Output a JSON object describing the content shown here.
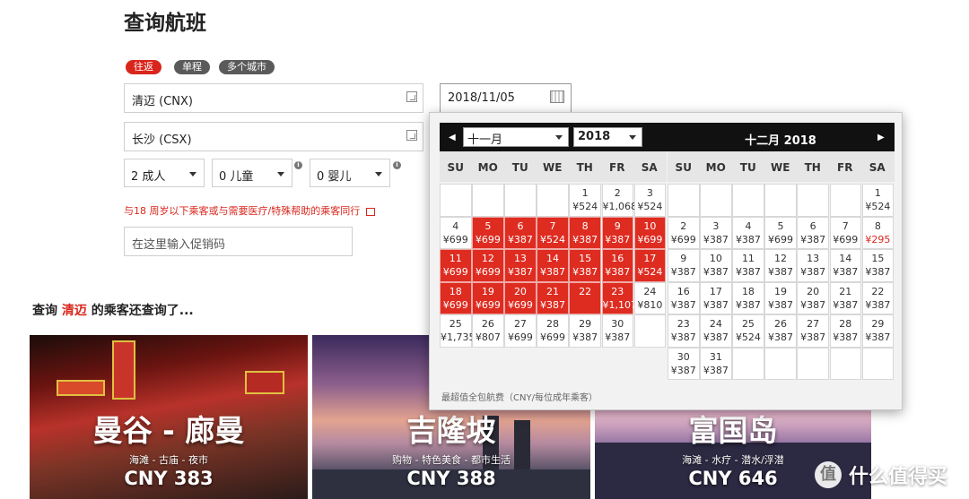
{
  "page_title": "查询航班",
  "trip_types": [
    "往返",
    "单程",
    "多个城市"
  ],
  "origin": "清迈 (CNX)",
  "destination": "长沙 (CSX)",
  "departure_date": "2018/11/05",
  "passengers": {
    "adults": "2 成人",
    "children": "0 儿童",
    "infants": "0 婴儿"
  },
  "assist_note": "与18 周岁以下乘客或与需要医疗/特殊帮助的乘客同行",
  "promo_placeholder": "在这里输入促销码",
  "also_searched": {
    "prefix": "查询 ",
    "city": "清迈",
    "suffix": " 的乘客还查询了..."
  },
  "destinations": [
    {
      "name": "曼谷 - 廊曼",
      "tags": "海滩 - 古庙 - 夜市",
      "price": "CNY 383"
    },
    {
      "name": "吉隆坡",
      "tags": "购物 - 特色美食 - 都市生活",
      "price": "CNY 388"
    },
    {
      "name": "富国岛",
      "tags": "海滩 - 水疗 - 潜水/浮潜",
      "price": "CNY 646"
    }
  ],
  "watermark": "什么值得买",
  "calendar": {
    "left_month_select": "十一月",
    "left_year_select": "2018",
    "right_month_title": "十二月  2018",
    "weekdays": [
      "SU",
      "MO",
      "TU",
      "WE",
      "TH",
      "FR",
      "SA"
    ],
    "footnote": "最超值全包航费（CNY/每位成年乘客）",
    "colors": {
      "selected_range": "#de2c21",
      "highlight_price": "#d9261c"
    },
    "november": [
      {
        "day": "1",
        "price": "¥524"
      },
      {
        "day": "2",
        "price": "¥1,068"
      },
      {
        "day": "3",
        "price": "¥524"
      },
      {
        "day": "4",
        "price": "¥699"
      },
      {
        "day": "5",
        "price": "¥699",
        "red": true
      },
      {
        "day": "6",
        "price": "¥387",
        "red": true
      },
      {
        "day": "7",
        "price": "¥524",
        "red": true
      },
      {
        "day": "8",
        "price": "¥387",
        "red": true
      },
      {
        "day": "9",
        "price": "¥387",
        "red": true
      },
      {
        "day": "10",
        "price": "¥699",
        "red": true
      },
      {
        "day": "11",
        "price": "¥699",
        "red": true
      },
      {
        "day": "12",
        "price": "¥699",
        "red": true
      },
      {
        "day": "13",
        "price": "¥387",
        "red": true
      },
      {
        "day": "14",
        "price": "¥387",
        "red": true
      },
      {
        "day": "15",
        "price": "¥387",
        "red": true
      },
      {
        "day": "16",
        "price": "¥387",
        "red": true
      },
      {
        "day": "17",
        "price": "¥524",
        "red": true
      },
      {
        "day": "18",
        "price": "¥699",
        "red": true
      },
      {
        "day": "19",
        "price": "¥699",
        "red": true
      },
      {
        "day": "20",
        "price": "¥699",
        "red": true
      },
      {
        "day": "21",
        "price": "¥387",
        "red": true
      },
      {
        "day": "22",
        "price": "",
        "red": true
      },
      {
        "day": "23",
        "price": "¥1,107",
        "red": true
      },
      {
        "day": "24",
        "price": "¥810"
      },
      {
        "day": "25",
        "price": "¥1,735"
      },
      {
        "day": "26",
        "price": "¥807"
      },
      {
        "day": "27",
        "price": "¥699"
      },
      {
        "day": "28",
        "price": "¥699"
      },
      {
        "day": "29",
        "price": "¥387"
      },
      {
        "day": "30",
        "price": "¥387"
      }
    ],
    "december": [
      {
        "day": "1",
        "price": "¥524"
      },
      {
        "day": "2",
        "price": "¥699"
      },
      {
        "day": "3",
        "price": "¥387"
      },
      {
        "day": "4",
        "price": "¥387"
      },
      {
        "day": "5",
        "price": "¥699"
      },
      {
        "day": "6",
        "price": "¥387"
      },
      {
        "day": "7",
        "price": "¥699"
      },
      {
        "day": "8",
        "price": "¥295",
        "highlight": true
      },
      {
        "day": "9",
        "price": "¥387"
      },
      {
        "day": "10",
        "price": "¥387"
      },
      {
        "day": "11",
        "price": "¥387"
      },
      {
        "day": "12",
        "price": "¥387"
      },
      {
        "day": "13",
        "price": "¥387"
      },
      {
        "day": "14",
        "price": "¥387"
      },
      {
        "day": "15",
        "price": "¥387"
      },
      {
        "day": "16",
        "price": "¥387"
      },
      {
        "day": "17",
        "price": "¥387"
      },
      {
        "day": "18",
        "price": "¥387"
      },
      {
        "day": "19",
        "price": "¥387"
      },
      {
        "day": "20",
        "price": "¥387"
      },
      {
        "day": "21",
        "price": "¥387"
      },
      {
        "day": "22",
        "price": "¥387"
      },
      {
        "day": "23",
        "price": "¥387"
      },
      {
        "day": "24",
        "price": "¥387"
      },
      {
        "day": "25",
        "price": "¥524"
      },
      {
        "day": "26",
        "price": "¥387"
      },
      {
        "day": "27",
        "price": "¥387"
      },
      {
        "day": "28",
        "price": "¥387"
      },
      {
        "day": "29",
        "price": "¥387"
      },
      {
        "day": "30",
        "price": "¥387"
      },
      {
        "day": "31",
        "price": "¥387"
      }
    ]
  }
}
